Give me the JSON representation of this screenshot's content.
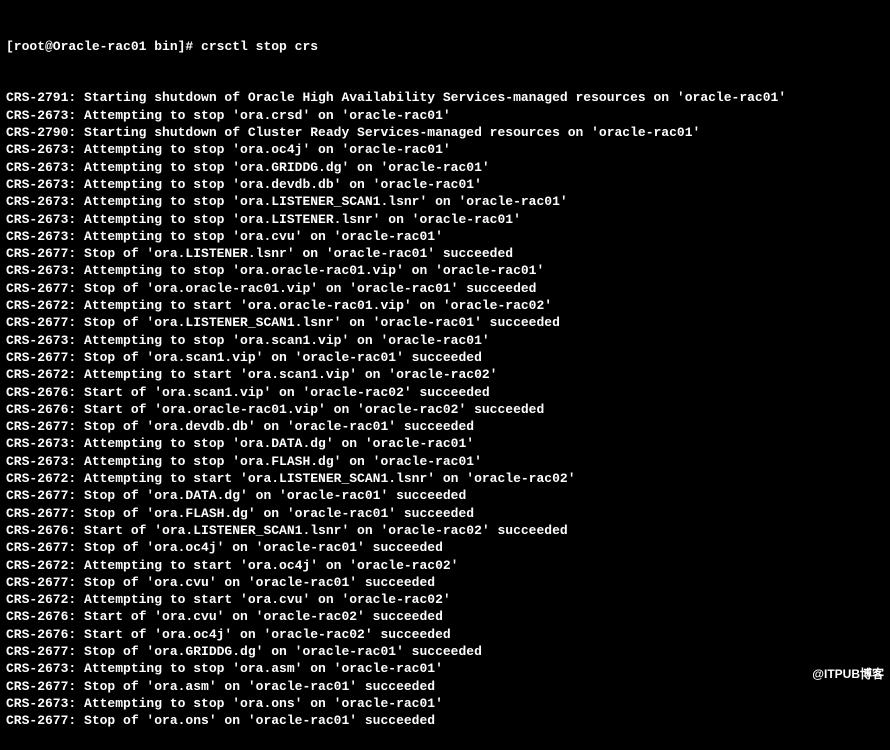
{
  "prompt": "[root@Oracle-rac01 bin]# ",
  "command": "crsctl stop crs",
  "watermark": "@ITPUB博客",
  "lines": [
    "CRS-2791: Starting shutdown of Oracle High Availability Services-managed resources on 'oracle-rac01'",
    "CRS-2673: Attempting to stop 'ora.crsd' on 'oracle-rac01'",
    "CRS-2790: Starting shutdown of Cluster Ready Services-managed resources on 'oracle-rac01'",
    "CRS-2673: Attempting to stop 'ora.oc4j' on 'oracle-rac01'",
    "CRS-2673: Attempting to stop 'ora.GRIDDG.dg' on 'oracle-rac01'",
    "CRS-2673: Attempting to stop 'ora.devdb.db' on 'oracle-rac01'",
    "CRS-2673: Attempting to stop 'ora.LISTENER_SCAN1.lsnr' on 'oracle-rac01'",
    "CRS-2673: Attempting to stop 'ora.LISTENER.lsnr' on 'oracle-rac01'",
    "CRS-2673: Attempting to stop 'ora.cvu' on 'oracle-rac01'",
    "CRS-2677: Stop of 'ora.LISTENER.lsnr' on 'oracle-rac01' succeeded",
    "CRS-2673: Attempting to stop 'ora.oracle-rac01.vip' on 'oracle-rac01'",
    "CRS-2677: Stop of 'ora.oracle-rac01.vip' on 'oracle-rac01' succeeded",
    "CRS-2672: Attempting to start 'ora.oracle-rac01.vip' on 'oracle-rac02'",
    "CRS-2677: Stop of 'ora.LISTENER_SCAN1.lsnr' on 'oracle-rac01' succeeded",
    "CRS-2673: Attempting to stop 'ora.scan1.vip' on 'oracle-rac01'",
    "CRS-2677: Stop of 'ora.scan1.vip' on 'oracle-rac01' succeeded",
    "CRS-2672: Attempting to start 'ora.scan1.vip' on 'oracle-rac02'",
    "CRS-2676: Start of 'ora.scan1.vip' on 'oracle-rac02' succeeded",
    "CRS-2676: Start of 'ora.oracle-rac01.vip' on 'oracle-rac02' succeeded",
    "CRS-2677: Stop of 'ora.devdb.db' on 'oracle-rac01' succeeded",
    "CRS-2673: Attempting to stop 'ora.DATA.dg' on 'oracle-rac01'",
    "CRS-2673: Attempting to stop 'ora.FLASH.dg' on 'oracle-rac01'",
    "CRS-2672: Attempting to start 'ora.LISTENER_SCAN1.lsnr' on 'oracle-rac02'",
    "CRS-2677: Stop of 'ora.DATA.dg' on 'oracle-rac01' succeeded",
    "CRS-2677: Stop of 'ora.FLASH.dg' on 'oracle-rac01' succeeded",
    "CRS-2676: Start of 'ora.LISTENER_SCAN1.lsnr' on 'oracle-rac02' succeeded",
    "CRS-2677: Stop of 'ora.oc4j' on 'oracle-rac01' succeeded",
    "CRS-2672: Attempting to start 'ora.oc4j' on 'oracle-rac02'",
    "CRS-2677: Stop of 'ora.cvu' on 'oracle-rac01' succeeded",
    "CRS-2672: Attempting to start 'ora.cvu' on 'oracle-rac02'",
    "CRS-2676: Start of 'ora.cvu' on 'oracle-rac02' succeeded",
    "CRS-2676: Start of 'ora.oc4j' on 'oracle-rac02' succeeded",
    "CRS-2677: Stop of 'ora.GRIDDG.dg' on 'oracle-rac01' succeeded",
    "CRS-2673: Attempting to stop 'ora.asm' on 'oracle-rac01'",
    "CRS-2677: Stop of 'ora.asm' on 'oracle-rac01' succeeded",
    "CRS-2673: Attempting to stop 'ora.ons' on 'oracle-rac01'",
    "CRS-2677: Stop of 'ora.ons' on 'oracle-rac01' succeeded"
  ]
}
